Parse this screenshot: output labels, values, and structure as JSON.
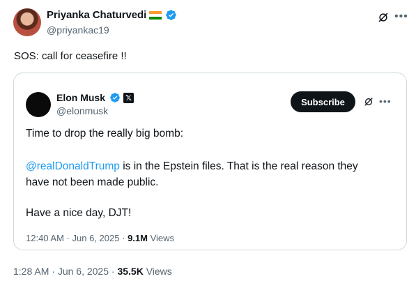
{
  "author": {
    "name": "Priyanka Chaturvedi",
    "handle": "@priyankac19",
    "flag_icon": "india-flag-icon",
    "verified_color": "#1d9bf0"
  },
  "tweet": {
    "text": "SOS: call for ceasefire !!",
    "time": "1:28 AM",
    "separator": "·",
    "date": "Jun 6, 2025",
    "view_count": "35.5K",
    "views_label": "Views"
  },
  "quote": {
    "author_name": "Elon Musk",
    "author_handle": "@elonmusk",
    "affiliate_badge": "𝕏",
    "subscribe_label": "Subscribe",
    "line1": "Time to drop the really big bomb:",
    "mention": "@realDonaldTrump",
    "line2_rest": " is in the Epstein files. That is the real reason they",
    "line3": "have not been made public.",
    "line4": "Have a nice day, DJT!",
    "time": "12:40 AM",
    "separator": "·",
    "date": "Jun 6, 2025",
    "separator2": "·",
    "view_count": "9.1M",
    "views_label": "Views"
  },
  "colors": {
    "accent": "#1d9bf0",
    "text_primary": "#0f1419",
    "text_secondary": "#536471",
    "border": "#cfd9de"
  }
}
